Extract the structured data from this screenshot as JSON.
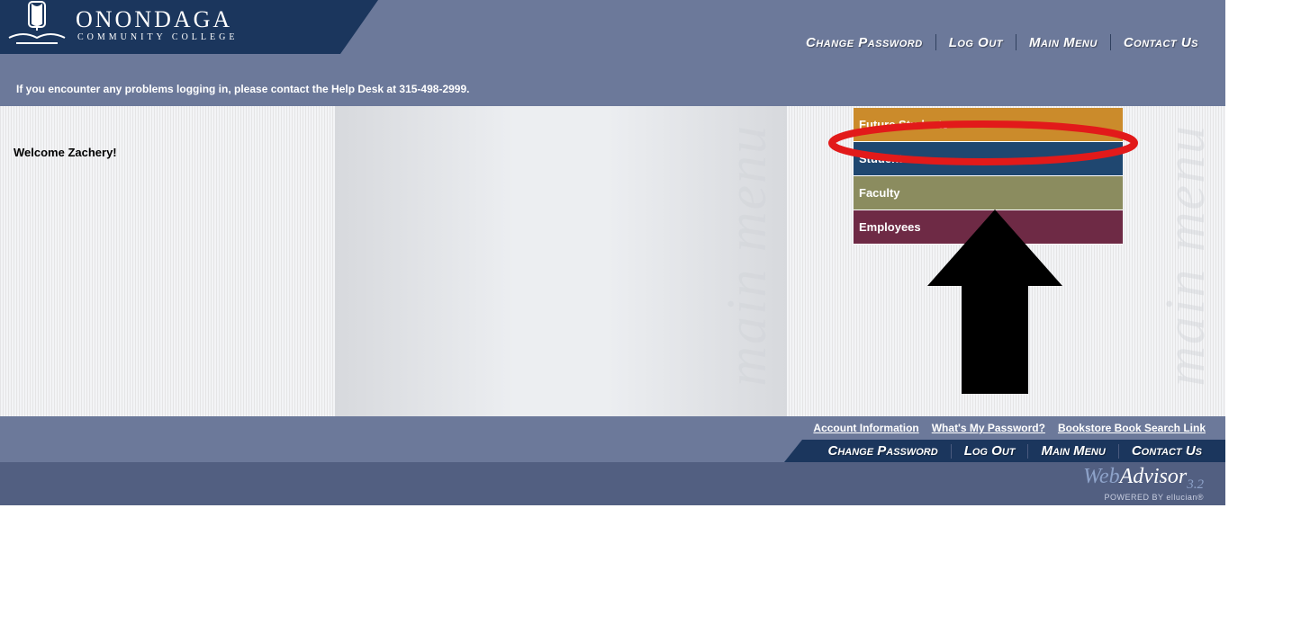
{
  "logo": {
    "title": "ONONDAGA",
    "subtitle": "COMMUNITY COLLEGE"
  },
  "nav": {
    "change_password": "Change Password",
    "log_out": "Log Out",
    "main_menu": "Main Menu",
    "contact_us": "Contact Us"
  },
  "help_dot": "•",
  "help_text": "If you encounter any problems logging in, please contact the Help Desk at 315-498-2999.",
  "welcome": "Welcome Zachery!",
  "watermark": "main menu",
  "menu": {
    "future_students": "Future Students",
    "students": "Students",
    "faculty": "Faculty",
    "employees": "Employees"
  },
  "footer_links": {
    "account_info": "Account Information",
    "whats_my_password": "What's My Password?",
    "bookstore": "Bookstore Book Search Link"
  },
  "brand": {
    "web": "Web",
    "advisor": "Advisor",
    "version": "3.2",
    "powered": "POWERED BY ellucian®"
  }
}
